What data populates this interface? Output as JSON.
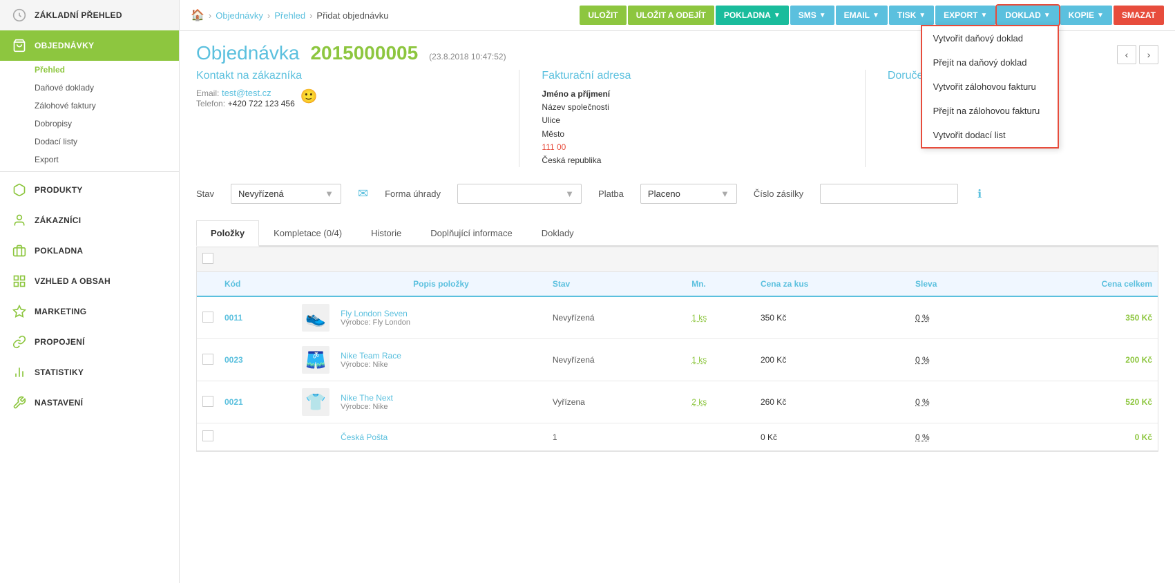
{
  "sidebar": {
    "logo": {
      "icon": "⚙",
      "text": "ZÁKLADNÍ PŘEHLED"
    },
    "items": [
      {
        "id": "prehled",
        "label": "ZÁKLADNÍ PŘEHLED",
        "icon": "home"
      },
      {
        "id": "objednavky",
        "label": "OBJEDNÁVKY",
        "icon": "cart",
        "active": true,
        "subitems": [
          {
            "id": "prehled-sub",
            "label": "Přehled",
            "active": true
          },
          {
            "id": "danove-doklady",
            "label": "Daňové doklady"
          },
          {
            "id": "zalohove-faktury",
            "label": "Zálohové faktury"
          },
          {
            "id": "dobropisy",
            "label": "Dobropisy"
          },
          {
            "id": "dodaci-listy",
            "label": "Dodací listy"
          },
          {
            "id": "export",
            "label": "Export"
          }
        ]
      },
      {
        "id": "produkty",
        "label": "PRODUKTY",
        "icon": "box"
      },
      {
        "id": "zakaznici",
        "label": "ZÁKAZNÍCI",
        "icon": "user"
      },
      {
        "id": "pokladna",
        "label": "POKLADNA",
        "icon": "register"
      },
      {
        "id": "vzhled",
        "label": "VZHLED A OBSAH",
        "icon": "grid"
      },
      {
        "id": "marketing",
        "label": "MARKETING",
        "icon": "star"
      },
      {
        "id": "propojeni",
        "label": "PROPOJENÍ",
        "icon": "link"
      },
      {
        "id": "statistiky",
        "label": "STATISTIKY",
        "icon": "chart"
      },
      {
        "id": "nastaveni",
        "label": "NASTAVENÍ",
        "icon": "wrench"
      }
    ]
  },
  "breadcrumb": {
    "home": "🏠",
    "items": [
      "Objednávky",
      "Přehled"
    ],
    "current": "Přidat objednávku"
  },
  "toolbar": {
    "ulozit": "ULOŽIT",
    "ulozit_odejit": "ULOŽIT A ODEJÍT",
    "pokladna": "POKLADNA",
    "sms": "SMS",
    "email": "EMAIL",
    "tisk": "TISK",
    "export": "EXPORT",
    "doklad": "DOKLAD",
    "kopie": "KOPIE",
    "smazat": "SMAZAT"
  },
  "doklad_menu": [
    {
      "id": "vytvorit-danovy",
      "label": "Vytvořit daňový doklad"
    },
    {
      "id": "prejit-danovy",
      "label": "Přejít na daňový doklad"
    },
    {
      "id": "vytvorit-zalohovou",
      "label": "Vytvořit zálohovou fakturu"
    },
    {
      "id": "prejit-zalohovou",
      "label": "Přejít na zálohovou fakturu"
    },
    {
      "id": "vytvorit-dodaci",
      "label": "Vytvořit dodací list"
    }
  ],
  "page": {
    "title": "Objednávka",
    "id": "2015000005",
    "date": "(23.8.2018 10:47:52)"
  },
  "contact": {
    "title": "Kontakt na zákazníka",
    "email_label": "Email:",
    "email": "test@test.cz",
    "phone_label": "Telefon:",
    "phone": "+420 722 123 456"
  },
  "billing": {
    "title": "Fakturační adresa",
    "name": "Jméno a příjmení",
    "company": "Název společnosti",
    "street": "Ulice",
    "city": "Město",
    "zip": "111 00",
    "country": "Česká republika"
  },
  "delivery": {
    "title": "Doruče"
  },
  "status_row": {
    "stav_label": "Stav",
    "stav_value": "Nevyřízená",
    "forma_label": "Forma úhrady",
    "forma_value": "",
    "platba_label": "Platba",
    "platba_value": "Placeno",
    "cislo_label": "Číslo zásilky",
    "cislo_value": ""
  },
  "tabs": [
    {
      "id": "polozky",
      "label": "Položky",
      "active": true
    },
    {
      "id": "kompletace",
      "label": "Kompletace (0/4)"
    },
    {
      "id": "historie",
      "label": "Historie"
    },
    {
      "id": "doplnujici",
      "label": "Doplňující informace"
    },
    {
      "id": "doklady",
      "label": "Doklady"
    }
  ],
  "table": {
    "columns": [
      {
        "id": "kod",
        "label": "Kód"
      },
      {
        "id": "img",
        "label": ""
      },
      {
        "id": "popis",
        "label": "Popis položky"
      },
      {
        "id": "stav",
        "label": "Stav"
      },
      {
        "id": "mn",
        "label": "Mn."
      },
      {
        "id": "cena_kus",
        "label": "Cena za kus"
      },
      {
        "id": "sleva",
        "label": "Sleva"
      },
      {
        "id": "cena_celkem",
        "label": "Cena celkem"
      }
    ],
    "rows": [
      {
        "kod": "0011",
        "img": "👟",
        "img_color": "#6655aa",
        "name": "Fly London Seven",
        "manufacturer": "Výrobce: Fly London",
        "stav": "Nevyřízená",
        "mn": "1 ks",
        "cena_kus": "350 Kč",
        "sleva": "0 %",
        "cena_celkem": "350 Kč"
      },
      {
        "kod": "0023",
        "img": "🩳",
        "img_color": "#cc2244",
        "name": "Nike Team Race",
        "manufacturer": "Výrobce: Nike",
        "stav": "Nevyřízená",
        "mn": "1 ks",
        "cena_kus": "200 Kč",
        "sleva": "0 %",
        "cena_celkem": "200 Kč"
      },
      {
        "kod": "0021",
        "img": "👕",
        "img_color": "#888888",
        "name": "Nike The Next",
        "manufacturer": "Výrobce: Nike",
        "stav": "Vyřízena",
        "mn": "2 ks",
        "cena_kus": "260 Kč",
        "sleva": "0 %",
        "cena_celkem": "520 Kč"
      },
      {
        "kod": "",
        "img": "",
        "name": "Česká Pošta",
        "manufacturer": "",
        "stav": "1",
        "mn": "",
        "cena_kus": "0 Kč",
        "sleva": "0 %",
        "cena_celkem": "0 Kč"
      }
    ]
  }
}
